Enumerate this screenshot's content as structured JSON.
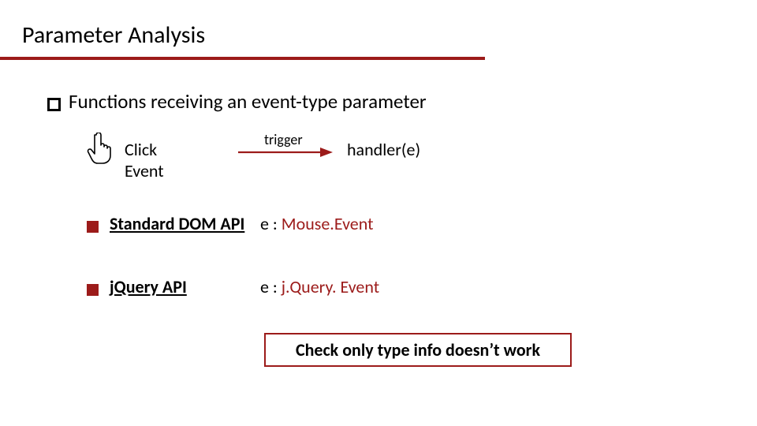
{
  "title": "Parameter Analysis",
  "bullet_main": "Functions receiving an event-type parameter",
  "flow": {
    "click_event": "Click Event",
    "trigger": "trigger",
    "handler": "handler(e)"
  },
  "apis": {
    "dom": {
      "label": "Standard DOM API",
      "value_prefix": "e : ",
      "value_type": "Mouse.Event"
    },
    "jquery": {
      "label": "jQuery API",
      "value_prefix": "e : ",
      "value_type": "j.Query. Event"
    }
  },
  "callout": "Check only type info doesn’t work"
}
